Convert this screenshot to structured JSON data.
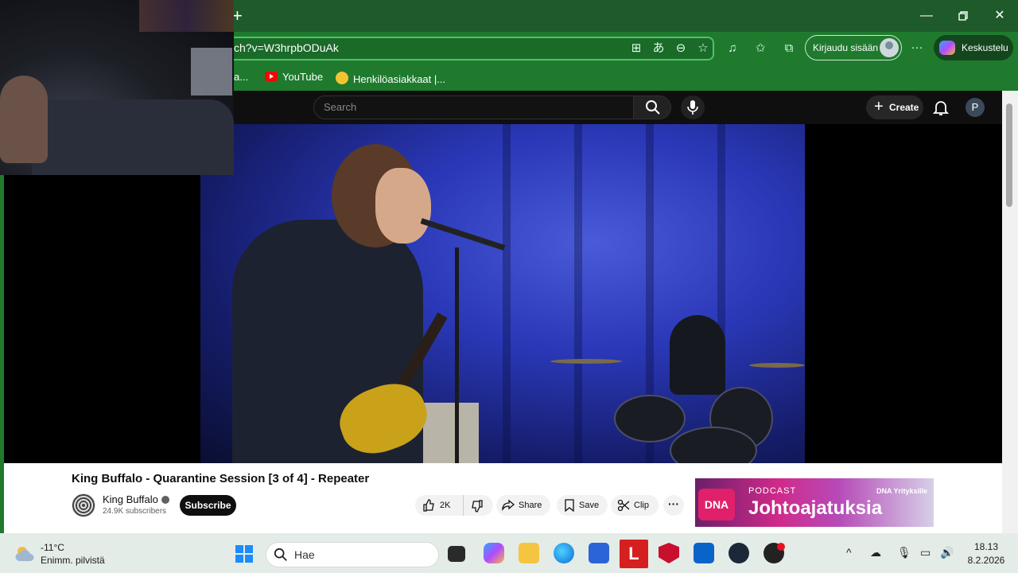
{
  "browser": {
    "url": "ch?v=W3hrpbODuAk",
    "signin_label": "Kirjaudu sisään",
    "copilot_label": "Keskustelu",
    "bookmarks": [
      {
        "label": "a..."
      },
      {
        "label": "YouTube"
      },
      {
        "label": "Henkilöasiakkaat |..."
      }
    ]
  },
  "youtube": {
    "search_placeholder": "Search",
    "create_label": "Create",
    "avatar_letter": "P",
    "video_title": "King Buffalo - Quarantine Session [3 of 4] - Repeater",
    "channel_name": "King Buffalo",
    "subscribers": "24.9K subscribers",
    "subscribe_label": "Subscribe",
    "likes": "2K",
    "share_label": "Share",
    "save_label": "Save",
    "clip_label": "Clip"
  },
  "ad": {
    "logo": "DNA",
    "kicker": "PODCAST",
    "title": "Johtoajatuksia",
    "brand": "DNA Yrityksille"
  },
  "taskbar": {
    "temperature": "-11°C",
    "weather": "Enimm. pilvistä",
    "search_placeholder": "Hae",
    "time": "18.13",
    "date": "8.2.2026"
  },
  "colors": {
    "browser_green": "#1f7a2e",
    "youtube_red": "#ff0000",
    "ad_pink": "#d02a8a"
  }
}
